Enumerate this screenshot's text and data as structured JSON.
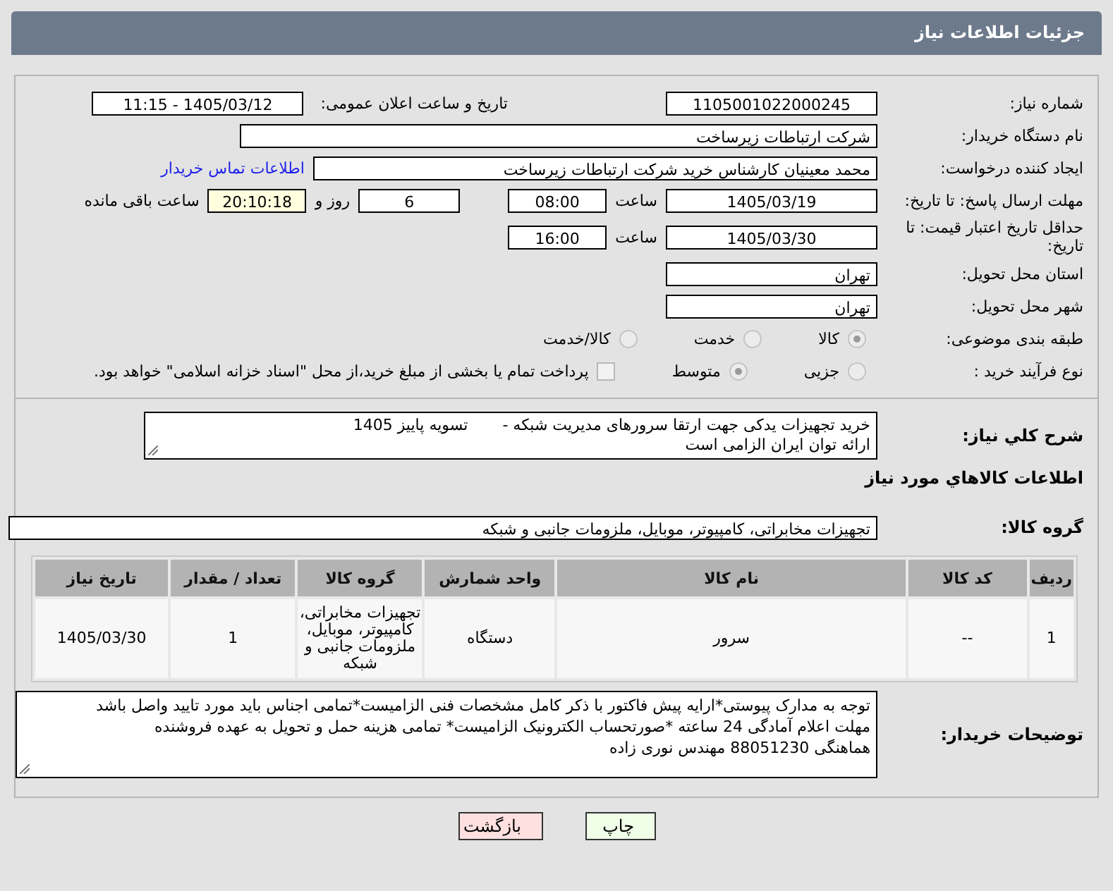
{
  "header": {
    "title": "جزئیات اطلاعات نیاز"
  },
  "need_number": {
    "label": "شماره نیاز:",
    "value": "1105001022000245"
  },
  "announce": {
    "label": "تاریخ و ساعت اعلان عمومی:",
    "value": "1405/03/12 - 11:15"
  },
  "buyer": {
    "label": "نام دستگاه خریدار:",
    "value": "شرکت ارتباطات زیرساخت"
  },
  "creator": {
    "label": "ایجاد کننده درخواست:",
    "value": "محمد معینیان کارشناس خرید شرکت ارتباطات زیرساخت",
    "link": "اطلاعات تماس خریدار"
  },
  "deadline": {
    "label": "مهلت ارسال پاسخ: تا تاریخ:",
    "date": "1405/03/19",
    "time_label": "ساعت",
    "time": "08:00",
    "days": "6",
    "days_label": "روز و",
    "remaining": "20:10:18",
    "remaining_label": "ساعت باقی مانده"
  },
  "validity": {
    "label": "حداقل تاریخ اعتبار قیمت: تا تاریخ:",
    "date": "1405/03/30",
    "time_label": "ساعت",
    "time": "16:00"
  },
  "province": {
    "label": "استان محل تحویل:",
    "value": "تهران"
  },
  "city": {
    "label": "شهر محل تحویل:",
    "value": "تهران"
  },
  "category": {
    "label": "طبقه بندی موضوعی:",
    "options": [
      {
        "label": "کالا",
        "selected": true
      },
      {
        "label": "خدمت",
        "selected": false
      },
      {
        "label": "کالا/خدمت",
        "selected": false
      }
    ]
  },
  "process": {
    "label": "نوع فرآیند خرید :",
    "options": [
      {
        "label": "جزیی",
        "selected": false
      },
      {
        "label": "متوسط",
        "selected": true
      }
    ],
    "treasury": {
      "label": "پرداخت تمام یا بخشی از مبلغ خرید،از محل \"اسناد خزانه اسلامی\" خواهد بود.",
      "checked": false
    }
  },
  "description": {
    "label": "شرح کلي نياز:",
    "lines": [
      "خرید تجهیزات یدکی جهت ارتقا سرورهای مدیریت شبکه -       تسویه پاییز 1405",
      "ارائه توان ایران الزامی است"
    ]
  },
  "goods_heading": "اطلاعات كالاهاي مورد نياز",
  "goods_group": {
    "label": "گروه کالا:",
    "value": "تجهیزات مخابراتی، کامپیوتر، موبایل، ملزومات جانبی و شبکه"
  },
  "table": {
    "columns": [
      "ردیف",
      "کد کالا",
      "نام کالا",
      "واحد شمارش",
      "گروه کالا",
      "تعداد / مقدار",
      "تاریخ نیاز"
    ],
    "rows": [
      [
        "1",
        "--",
        "سرور",
        "دستگاه",
        "تجهیزات مخابراتی، کامپیوتر، موبایل، ملزومات جانبی و شبکه",
        "1",
        "1405/03/30"
      ]
    ]
  },
  "buyer_notes": {
    "label": "توضیحات خریدار:",
    "lines": [
      "توجه به مدارک پیوستی*ارایه پیش فاکتور با ذکر کامل مشخصات فنی الزامیست*تمامی اجناس باید مورد تایید واصل باشد",
      "مهلت اعلام آمادگی 24 ساعته *صورتحساب الکترونیک الزامیست* تمامی هزینه حمل و تحویل به عهده فروشنده",
      "هماهنگی 88051230 مهندس نوری زاده"
    ]
  },
  "buttons": [
    {
      "kind": "print",
      "label": "چاپ"
    },
    {
      "kind": "back",
      "label": "بازگشت"
    }
  ]
}
